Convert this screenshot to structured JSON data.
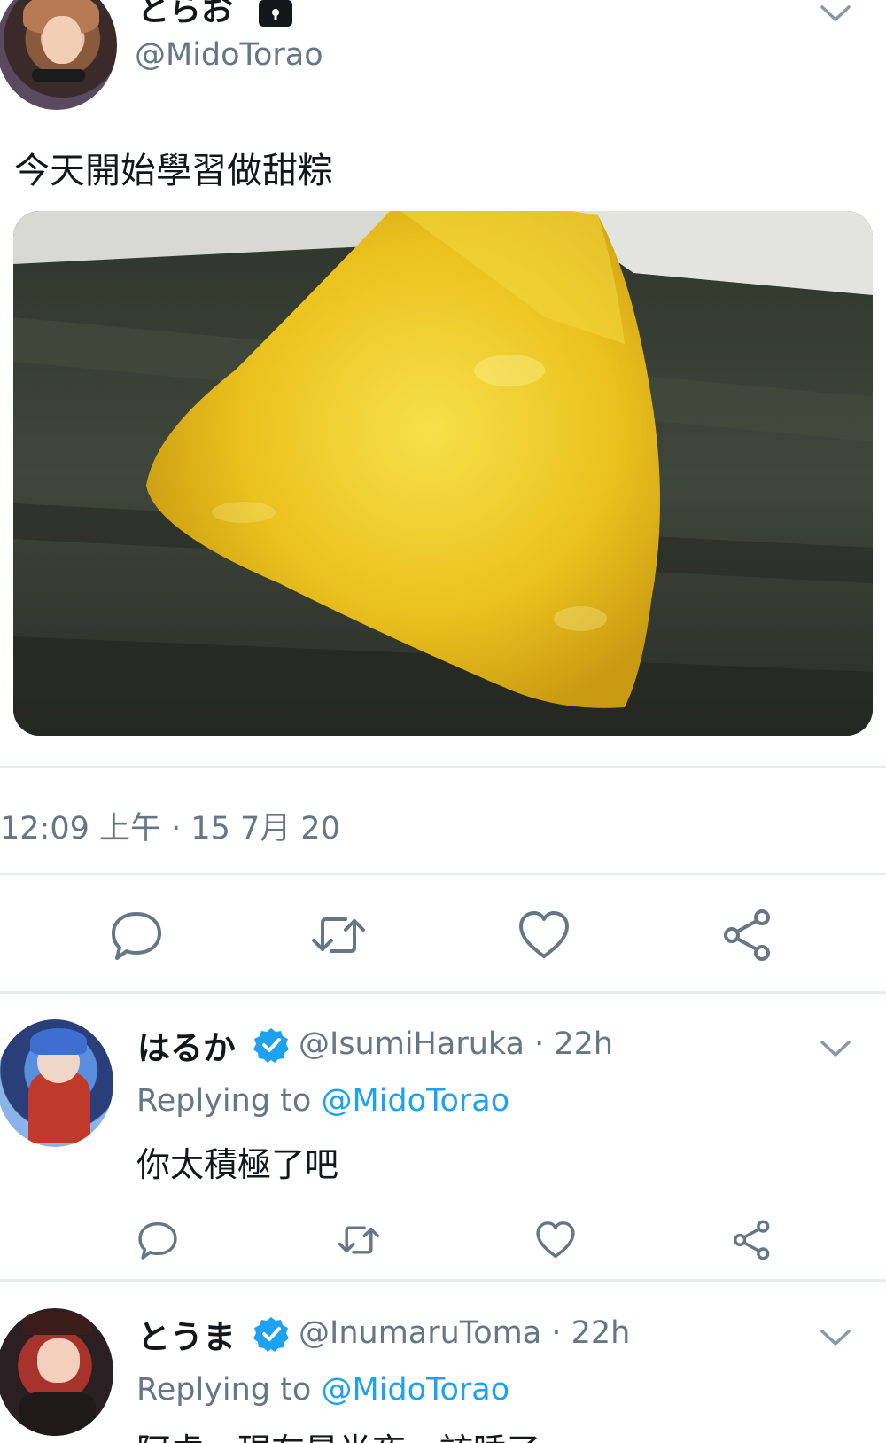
{
  "main_tweet": {
    "display_name": "とらお",
    "handle": "@MidoTorao",
    "text": "今天開始學習做甜粽",
    "timestamp": "12:09 上午 · 15 7月 20",
    "avatar_icon": "user-avatar",
    "locked_icon": "lock-icon"
  },
  "replies": [
    {
      "display_name": "はるか",
      "handle": "@IsumiHaruka",
      "time": "· 22h",
      "replying_label": "Replying to",
      "replying_handle": "@MidoTorao",
      "text": "你太積極了吧"
    },
    {
      "display_name": "とうま",
      "handle": "@InumaruToma",
      "time": "· 22h",
      "replying_label": "Replying to",
      "replying_handle": "@MidoTorao",
      "text": "阿虎，現在是半夜，該睡了"
    }
  ],
  "colors": {
    "accent": "#1da1f2",
    "secondary_text": "#657786",
    "icon_gray": "#657786",
    "divider": "#e6ecf0"
  }
}
